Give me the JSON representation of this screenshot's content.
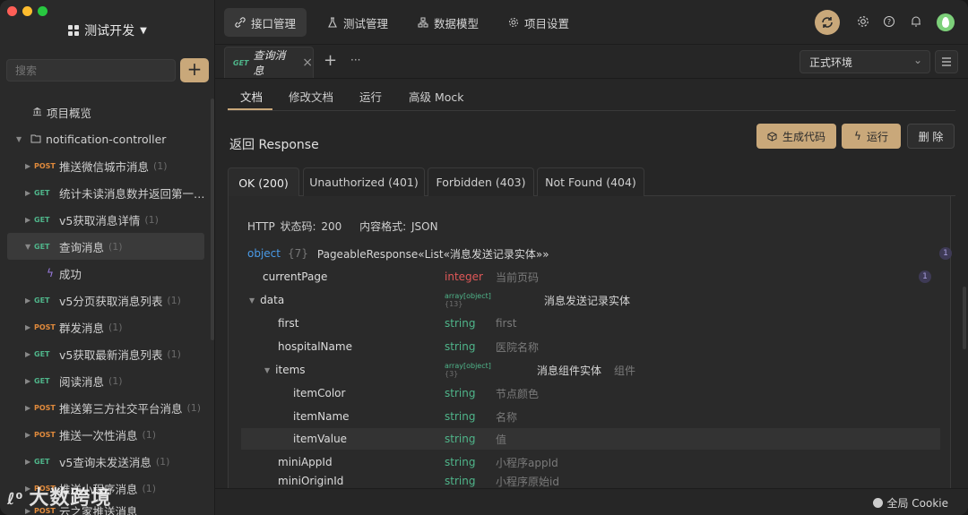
{
  "sidebar": {
    "project_name": "测试开发",
    "search_placeholder": "搜索",
    "add_label": "+",
    "overview_label": "项目概览",
    "folder_label": "notification-controller",
    "items": [
      {
        "method": "POST",
        "label": "推送微信城市消息",
        "count": "(1)"
      },
      {
        "method": "GET",
        "label": "统计未读消息数并返回第一…",
        "count": ""
      },
      {
        "method": "GET",
        "label": "v5获取消息详情",
        "count": "(1)"
      },
      {
        "method": "GET",
        "label": "查询消息",
        "count": "(1)"
      },
      {
        "method": "",
        "label": "成功",
        "count": ""
      },
      {
        "method": "GET",
        "label": "v5分页获取消息列表",
        "count": "(1)"
      },
      {
        "method": "POST",
        "label": "群发消息",
        "count": "(1)"
      },
      {
        "method": "GET",
        "label": "v5获取最新消息列表",
        "count": "(1)"
      },
      {
        "method": "GET",
        "label": "阅读消息",
        "count": "(1)"
      },
      {
        "method": "POST",
        "label": "推送第三方社交平台消息",
        "count": "(1)"
      },
      {
        "method": "POST",
        "label": "推送一次性消息",
        "count": "(1)"
      },
      {
        "method": "GET",
        "label": "v5查询未发送消息",
        "count": "(1)"
      },
      {
        "method": "POST",
        "label": "推送小程序消息",
        "count": "(1)"
      },
      {
        "method": "POST",
        "label": "云之家推送消息",
        "count": ""
      }
    ]
  },
  "topnav": {
    "items": [
      "接口管理",
      "测试管理",
      "数据模型",
      "项目设置"
    ]
  },
  "doctab": {
    "method": "GET",
    "title": "查询消息",
    "close": "×",
    "plus": "+",
    "more": "···"
  },
  "env": {
    "label": "正式环境"
  },
  "subtabs": [
    "文档",
    "修改文档",
    "运行",
    "高级 Mock"
  ],
  "section": {
    "title": "返回 Response",
    "gen_code": "生成代码",
    "run": "运行",
    "delete": "删 除"
  },
  "resp_tabs": [
    "OK (200)",
    "Unauthorized (401)",
    "Forbidden (403)",
    "Not Found (404)"
  ],
  "meta": {
    "status": "HTTP 状态码: 200",
    "format": "内容格式: JSON"
  },
  "schema": {
    "root_type": "object",
    "root_count": "{7}",
    "root_name": "PageableResponse«List«消息发送记录实体»»",
    "badge": "1",
    "rows": [
      {
        "name": "currentPage",
        "type": "integer",
        "desc": "当前页码",
        "badge": "1"
      },
      {
        "name": "data",
        "type": "array[object]",
        "count": "{13}",
        "desc": "消息发送记录实体"
      },
      {
        "name": "first",
        "type": "string",
        "desc": "first"
      },
      {
        "name": "hospitalName",
        "type": "string",
        "desc": "医院名称"
      },
      {
        "name": "items",
        "type": "array[object]",
        "count": "{3}",
        "desc": "消息组件实体",
        "extra": "组件"
      },
      {
        "name": "itemColor",
        "type": "string",
        "desc": "节点颜色"
      },
      {
        "name": "itemName",
        "type": "string",
        "desc": "名称"
      },
      {
        "name": "itemValue",
        "type": "string",
        "desc": "值"
      },
      {
        "name": "miniAppId",
        "type": "string",
        "desc": "小程序appId"
      },
      {
        "name": "miniOriginId",
        "type": "string",
        "desc": "小程序原始id"
      }
    ]
  },
  "footer": {
    "cookie": "全局 Cookie"
  },
  "watermark": "大数跨境"
}
